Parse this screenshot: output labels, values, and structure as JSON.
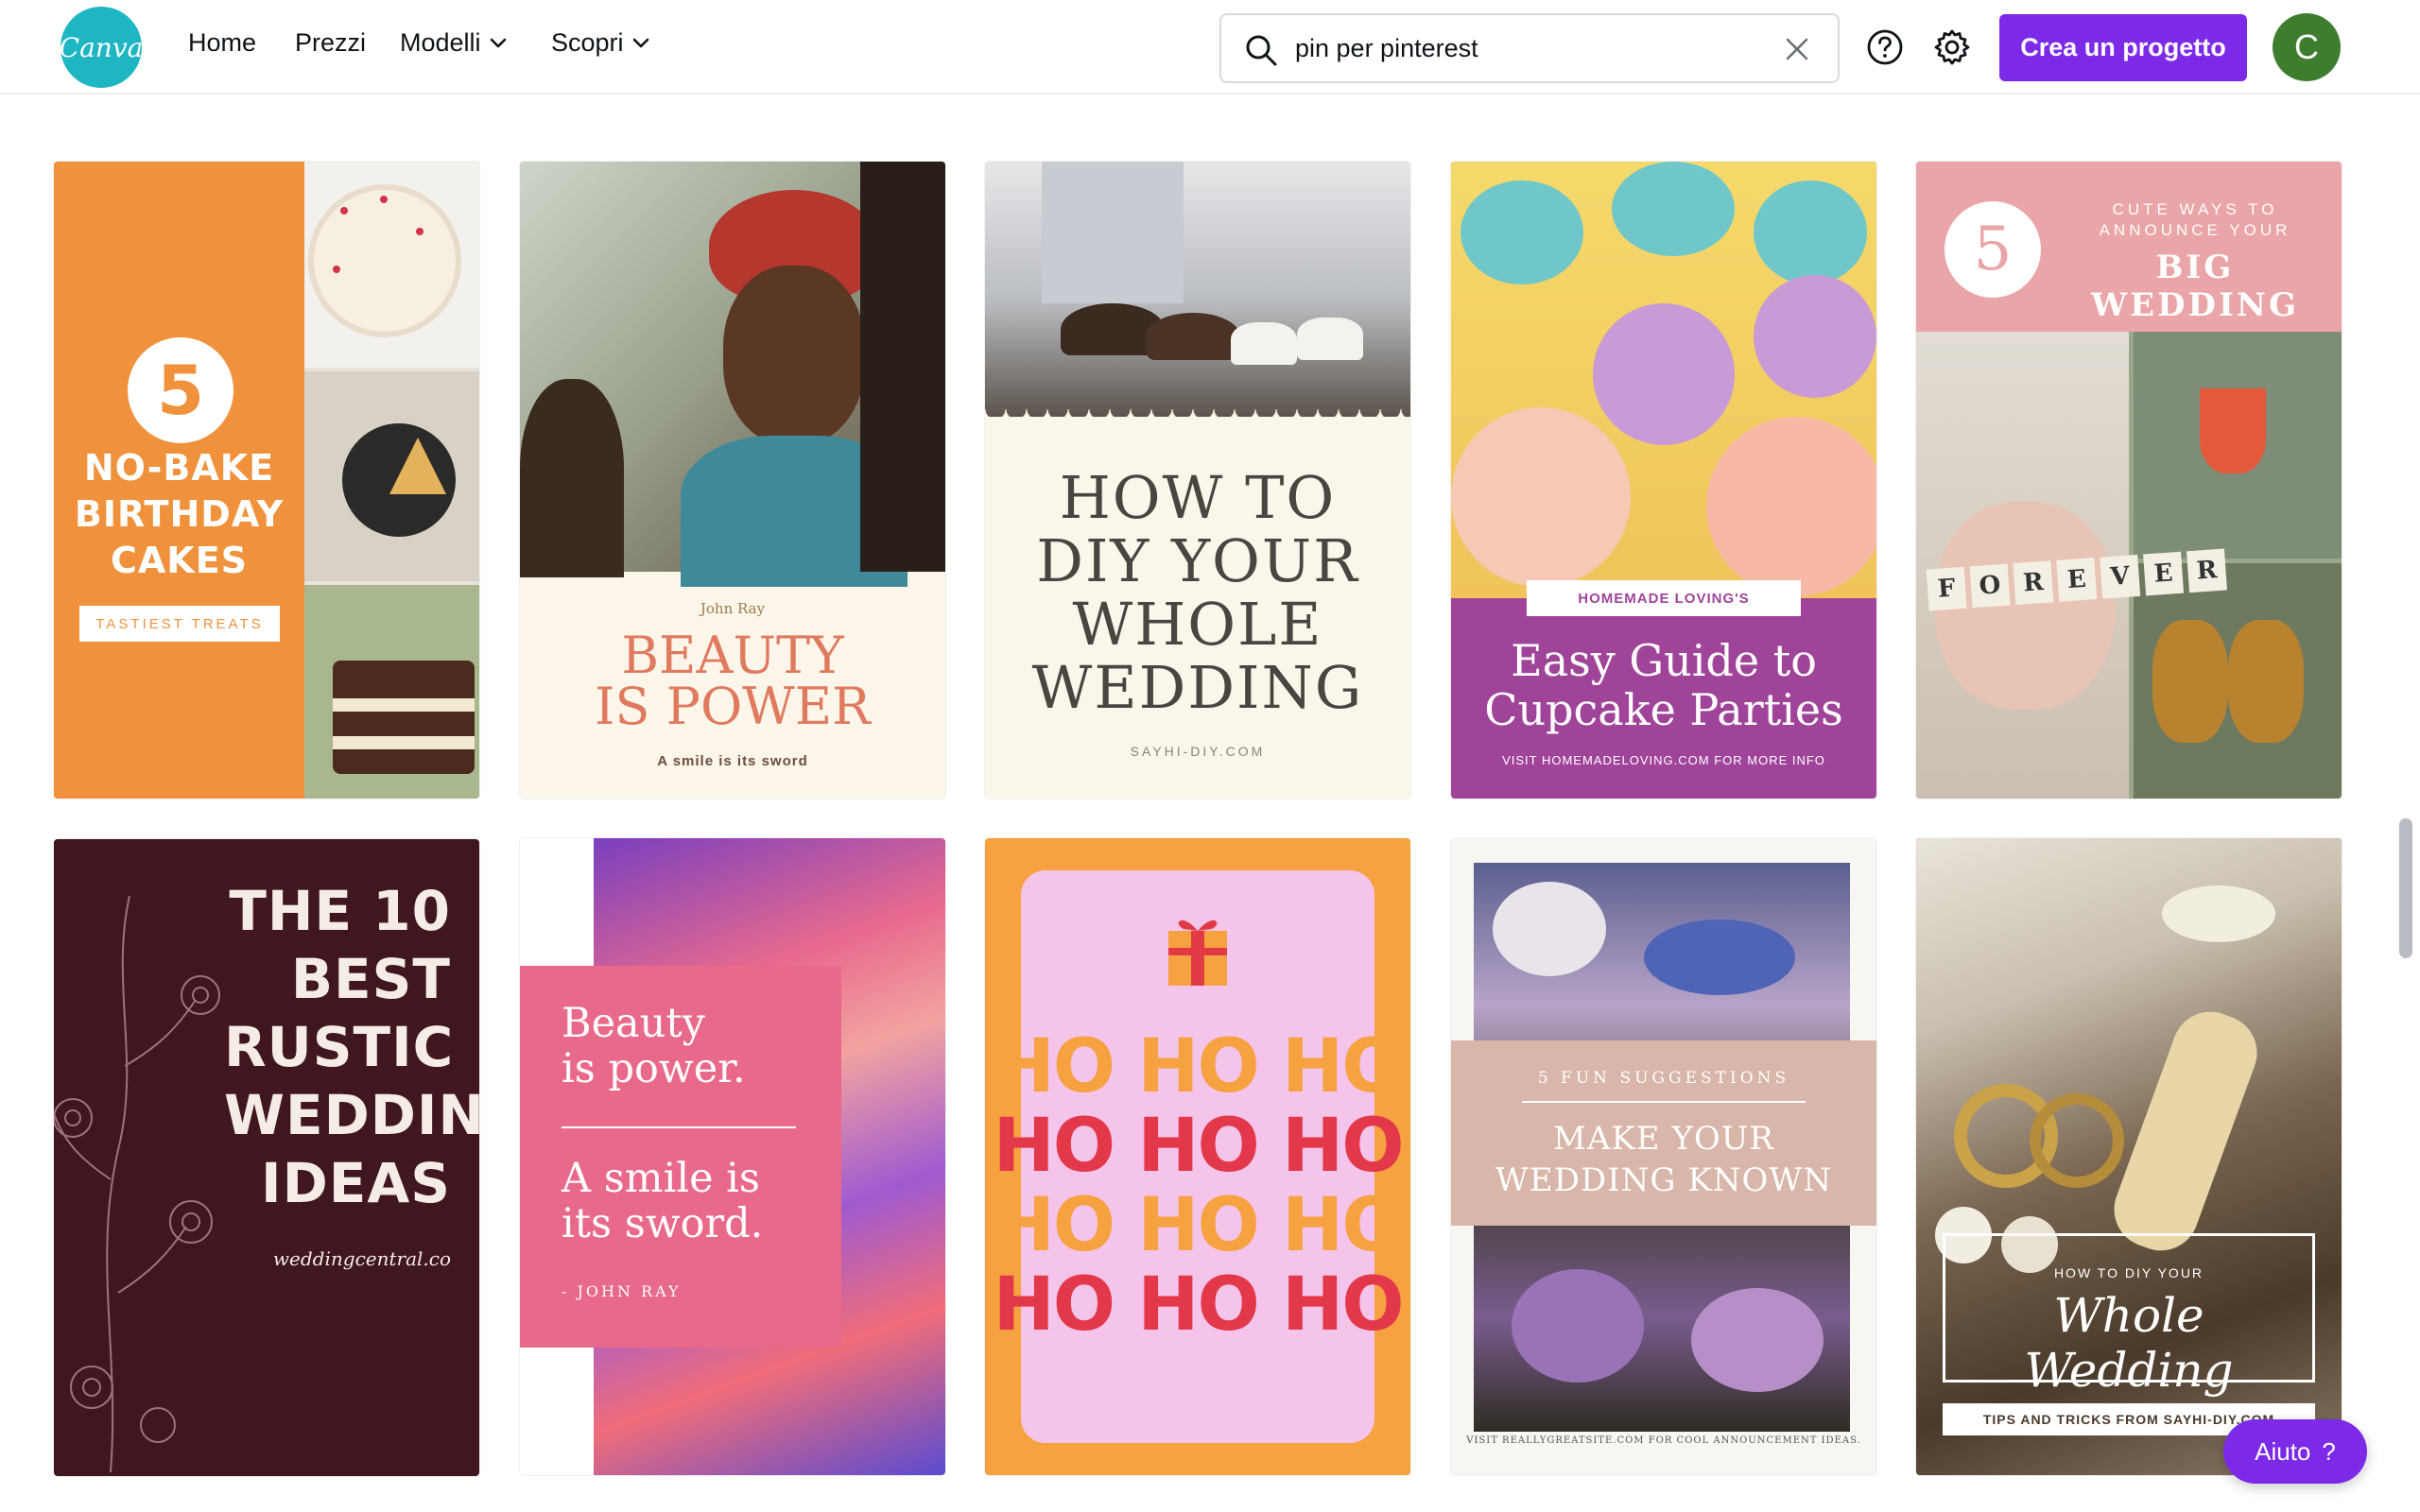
{
  "nav": {
    "logo_text": "Canva",
    "items": [
      {
        "label": "Home"
      },
      {
        "label": "Prezzi"
      },
      {
        "label": "Modelli"
      },
      {
        "label": "Scopri"
      }
    ],
    "search_value": "pin per pinterest",
    "create_label": "Crea un progetto",
    "avatar_initial": "C"
  },
  "templates": [
    {
      "number": "5",
      "title": "NO-BAKE BIRTHDAY CAKES",
      "title_lines": [
        "NO-BAKE",
        "BIRTHDAY",
        "CAKES"
      ],
      "tag": "TASTIEST TREATS",
      "bg": "#f0913c"
    },
    {
      "author": "John Ray",
      "title_lines": [
        "BEAUTY",
        "IS POWER"
      ],
      "subtitle": "A smile is its sword",
      "accent": "#e07a5f"
    },
    {
      "title_lines": [
        "HOW TO",
        "DIY YOUR",
        "WHOLE",
        "WEDDING"
      ],
      "footer": "SAYHI-DIY.COM"
    },
    {
      "kicker": "HOMEMADE LOVING'S",
      "title_lines": [
        "Easy Guide to",
        "Cupcake Parties"
      ],
      "footer": "VISIT HOMEMADELOVING.COM FOR MORE INFO",
      "accent": "#a0449a"
    },
    {
      "number": "5",
      "kicker_lines": [
        "CUTE WAYS TO",
        "ANNOUNCE YOUR"
      ],
      "title": "BIG WEDDING",
      "tiles": [
        "F",
        "O",
        "R",
        "E",
        "V",
        "E",
        "R"
      ],
      "bg": "#e9a5a7"
    },
    {
      "title_lines": [
        "THE 10",
        "BEST",
        "RUSTIC",
        "WEDDING",
        "IDEAS"
      ],
      "url": "weddingcentral.co",
      "bg": "#40161f"
    },
    {
      "title_lines": [
        "Beauty",
        "is power."
      ],
      "quote_lines": [
        "A smile is",
        "its sword."
      ],
      "author": "- JOHN RAY",
      "accent": "#e9698b"
    },
    {
      "lines": [
        "HO HO HO",
        "HO HO HO",
        "HO HO HO",
        "HO HO HO"
      ],
      "bg": "#f6a240",
      "inner": "#f4c4ea"
    },
    {
      "kicker": "5 FUN SUGGESTIONS",
      "title_lines": [
        "MAKE YOUR",
        "WEDDING KNOWN"
      ],
      "footer": "VISIT REALLYGREATSITE.COM FOR COOL ANNOUNCEMENT IDEAS."
    },
    {
      "kicker": "HOW TO DIY YOUR",
      "title": "Whole Wedding",
      "footer": "TIPS AND TRICKS FROM SAYHI-DIY.COM"
    }
  ],
  "help": {
    "label": "Aiuto",
    "icon": "?"
  }
}
